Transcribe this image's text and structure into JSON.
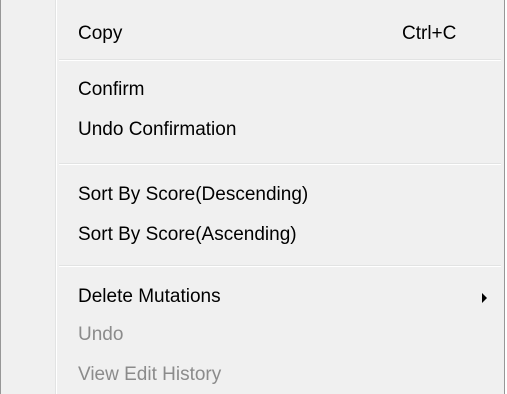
{
  "menu": {
    "items": [
      {
        "label": "Copy",
        "shortcut": "Ctrl+C",
        "enabled": true
      },
      {
        "label": "Confirm",
        "enabled": true
      },
      {
        "label": "Undo Confirmation",
        "enabled": true
      },
      {
        "label": "Sort By Score(Descending)",
        "enabled": true
      },
      {
        "label": "Sort By Score(Ascending)",
        "enabled": true
      },
      {
        "label": "Delete Mutations",
        "has_submenu": true,
        "enabled": true
      },
      {
        "label": "Undo",
        "enabled": false
      },
      {
        "label": "View Edit History",
        "enabled": false
      }
    ]
  },
  "colors": {
    "menu_background": "#f0f0f0",
    "enabled_text": "#000000",
    "disabled_text": "#8b8b8b",
    "border": "#979797"
  }
}
